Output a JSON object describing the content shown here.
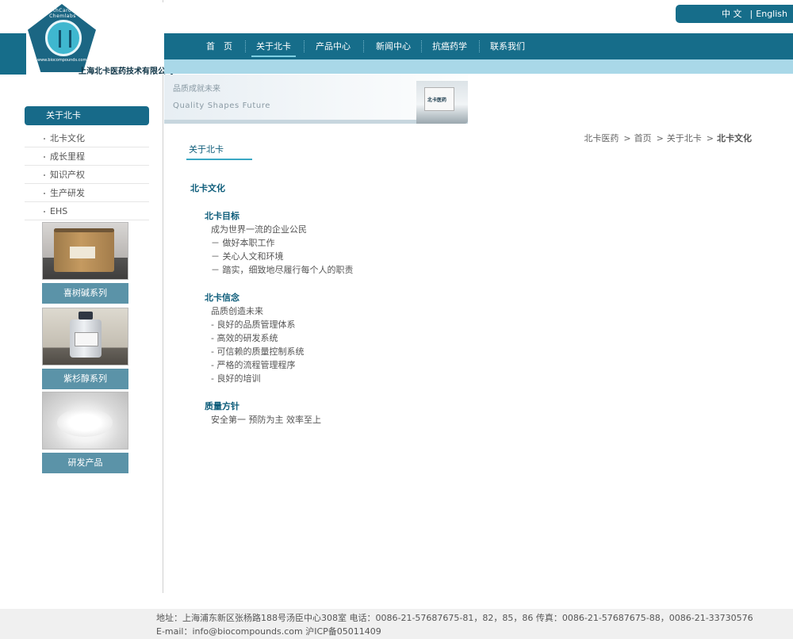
{
  "logo": {
    "arc_text": "NorthCarolina Chemlabs",
    "url_text": "www.biocompounds.com",
    "company_name": "上海北卡医药技术有限公司"
  },
  "language": {
    "chinese": "中 文",
    "separator": "|",
    "english": "English"
  },
  "nav": {
    "items": [
      {
        "label": "首　页",
        "active": false
      },
      {
        "label": "关于北卡",
        "active": true
      },
      {
        "label": "产品中心",
        "active": false
      },
      {
        "label": "新闻中心",
        "active": false
      },
      {
        "label": "抗癌药学",
        "active": false
      },
      {
        "label": "联系我们",
        "active": false
      }
    ]
  },
  "banner": {
    "slogan_cn": "品质成就未来",
    "slogan_en": "Quality  Shapes  Future",
    "sign_text": "北卡医药"
  },
  "sidebar": {
    "title": "关于北卡",
    "items": [
      "北卡文化",
      "成长里程",
      "知识产权",
      "生产研发",
      "EHS"
    ],
    "products": [
      {
        "label": "喜树碱系列"
      },
      {
        "label": "紫杉醇系列"
      },
      {
        "label": "研发产品"
      }
    ]
  },
  "breadcrumb": {
    "items": [
      "北卡医药",
      "首页",
      "关于北卡"
    ],
    "separator": ">",
    "current": "北卡文化"
  },
  "section": {
    "title": "关于北卡"
  },
  "content": {
    "heading": "北卡文化",
    "blocks": [
      {
        "title": "北卡目标",
        "lines": [
          "成为世界一流的企业公民",
          "－  做好本职工作",
          "－  关心人文和环境",
          "－  踏实，细致地尽履行每个人的职责"
        ]
      },
      {
        "title": "北卡信念",
        "lines": [
          "品质创造未来",
          "- 良好的品质管理体系",
          "- 高效的研发系统",
          "- 可信赖的质量控制系统",
          "- 严格的流程管理程序",
          "- 良好的培训"
        ]
      },
      {
        "title": "质量方针",
        "lines": [
          "安全第一  预防为主  效率至上"
        ]
      }
    ]
  },
  "footer": {
    "text": "地址：上海浦东新区张杨路188号汤臣中心308室  电话：0086-21-57687675-81，82，85，86 传真：0086-21-57687675-88，0086-21-33730576 E-mail：info@biocompounds.com 沪ICP备05011409"
  },
  "colors": {
    "brand": "#166d8a",
    "light_band": "#a9d8e8",
    "product_label": "#5b93a8"
  }
}
